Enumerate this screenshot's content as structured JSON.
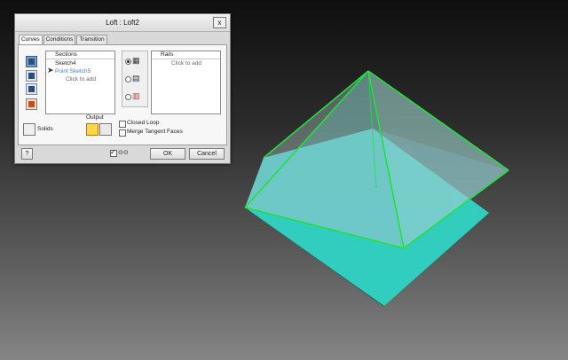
{
  "dialog": {
    "title": "Loft : Loft2",
    "close_glyph": "x",
    "tabs": [
      {
        "label": "Curves"
      },
      {
        "label": "Conditions"
      },
      {
        "label": "Transition"
      }
    ],
    "sections": {
      "header": "Sections",
      "items": [
        "Sketch4",
        "Point Sketch5"
      ],
      "add_hint": "Click to add"
    },
    "rails": {
      "header": "Rails",
      "add_hint": "Click to add"
    },
    "output_label": "Output",
    "solids_label": "Solids",
    "closed_loop_label": "Closed Loop",
    "merge_tangent_label": "Merge Tangent Faces",
    "ok_label": "OK",
    "cancel_label": "Cancel",
    "preview_glyph": "⊙⊙"
  },
  "colors": {
    "pyramid_edge": "#22e040",
    "plane_fill": "#31d4c4",
    "plane_underside": "#2f6b5e"
  }
}
